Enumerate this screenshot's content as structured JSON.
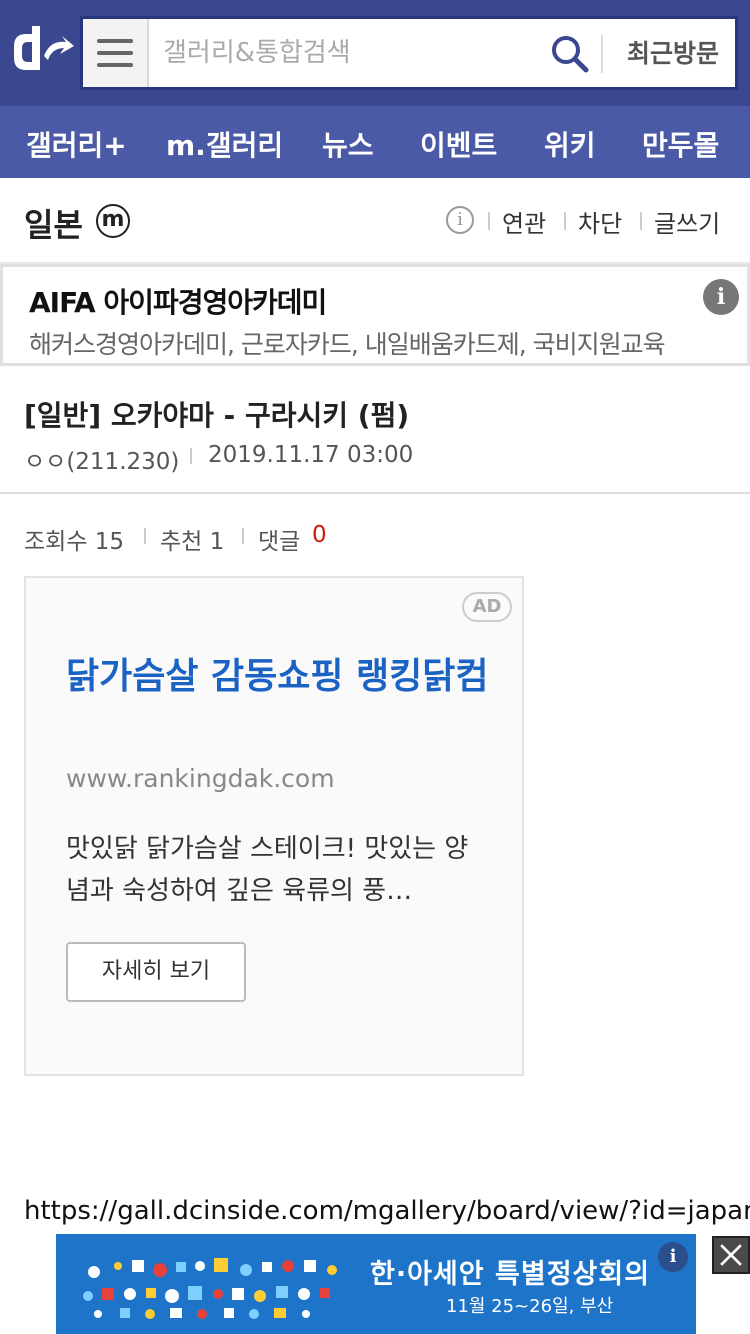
{
  "header": {
    "search_placeholder": "갤러리&통합검색",
    "recent_label": "최근방문"
  },
  "nav": {
    "items": [
      {
        "label": "갤러리+"
      },
      {
        "label": "m.갤러리"
      },
      {
        "label": "뉴스"
      },
      {
        "label": "이벤트"
      },
      {
        "label": "위키"
      },
      {
        "label": "만두몰"
      }
    ]
  },
  "gallery": {
    "title": "일본",
    "badge": "m",
    "info_glyph": "i",
    "links": [
      "연관",
      "차단",
      "글쓰기"
    ]
  },
  "ad_banner": {
    "title": "AIFA 아이파경영아카데미",
    "description": "해커스경영아카데미, 근로자카드, 내일배움카드제, 국비지원교육",
    "info_glyph": "i"
  },
  "post": {
    "title": "[일반] 오카야마 - 구라시키 (펌)",
    "author": "ㅇㅇ(211.230)",
    "date": "2019.11.17 03:00",
    "stats": {
      "views_label": "조회수 15",
      "recommend_label": "추천 1",
      "comments_label": "댓글",
      "comments_count": "0"
    }
  },
  "ad_card": {
    "badge": "AD",
    "title": "닭가슴살 감동쇼핑 랭킹닭컴",
    "url": "www.rankingdak.com",
    "description": "맛있닭 닭가슴살 스테이크! 맛있는 양념과 숙성하여 깊은 육류의 풍…",
    "button_label": "자세히 보기"
  },
  "url_line": "https://gall.dcinside.com/mgallery/board/view/?id=japan",
  "bottom_ad": {
    "title": "한·아세안 특별정상회의",
    "subtitle": "11월 25~26일, 부산",
    "info_glyph": "i",
    "color": "#1d74c8"
  },
  "colors": {
    "header_bg": "#3b4890",
    "nav_bg": "#4b5aa6",
    "ad_title": "#1a62c4",
    "comment_count": "#d31900"
  }
}
